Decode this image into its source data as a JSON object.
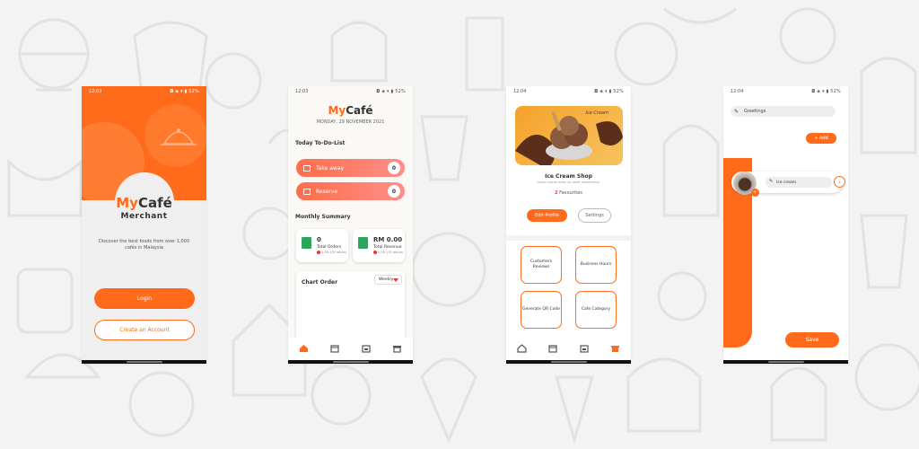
{
  "colors": {
    "accent": "#ff6b1a",
    "background": "#f3f3f3",
    "doodle": "#e4e4e4"
  },
  "screen1": {
    "status_time": "12:03",
    "status_right": "◘ ◈ ▾ ▮ 52%",
    "logo_my": "My",
    "logo_cafe": "Café",
    "subtitle": "Merchant",
    "tagline": "Discover the best foods from over 1,000 cafés in Malaysia",
    "login_label": "Login",
    "create_label": "Create an Account"
  },
  "screen2": {
    "status_time": "12:03",
    "status_right": "◘ ◈ ▾ ▮ 52%",
    "logo_my": "My",
    "logo_cafe": "Café",
    "date": "MONDAY, 29 NOVEMBER 2021",
    "todo_title": "Today To-Do-List",
    "todo": [
      {
        "label": "Take away",
        "count": "0"
      },
      {
        "label": "Reserve",
        "count": "0"
      }
    ],
    "summary_title": "Monthly Summary",
    "orders": {
      "value": "0",
      "label": "Total Orders",
      "sub": "0.0% (Of return)"
    },
    "revenue": {
      "value": "RM 0.00",
      "label": "Total Revenue",
      "sub": "0.0% (Of return)"
    },
    "chart_title": "Chart Order",
    "chart_period": "Weekly",
    "tabs": [
      "home-icon",
      "calendar-icon",
      "store-icon",
      "shop-icon"
    ]
  },
  "screen3": {
    "status_time": "12:04",
    "status_right": "◘ ◈ ▾ ▮ 52%",
    "banner_text": "Ice Cream",
    "shop_name": "Ice Cream Shop",
    "shop_sub": "Lorem ipsum dolor sit amet consectetur",
    "favourites_count": "2",
    "favourites_label": "Favourites",
    "edit_label": "Edit Profile",
    "settings_label": "Settings",
    "grid": [
      "Customers Reviews",
      "Business Hours",
      "Generate QR Code",
      "Cafe Category"
    ]
  },
  "screen4": {
    "status_time": "12:04",
    "status_right": "◘ ◈ ▾ ▮ 52%",
    "greetings": "Greetings",
    "add_label": "+ Add",
    "item_name": "Ice cream",
    "save_label": "Save"
  }
}
